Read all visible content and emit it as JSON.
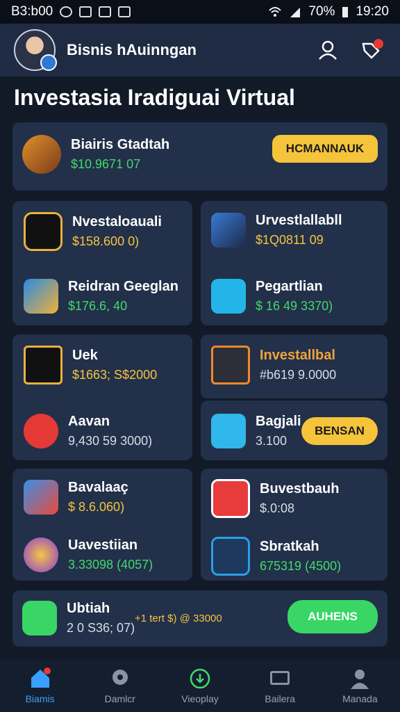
{
  "status_bar": {
    "left_time": "B3:b00",
    "battery": "70%",
    "time": "19:20"
  },
  "header": {
    "name": "Bisnis hAuinngan"
  },
  "page_title": "Investasia Iradiguai Virtual",
  "featured": {
    "name": "Biairis Gtadtah",
    "value": "$10.9671 07",
    "button": "HCMANNAUK"
  },
  "grid": [
    {
      "name": "Nvestaloauali",
      "value": "$158.600 0)",
      "color": "gold"
    },
    {
      "name": "Urvestlallabll",
      "value": "$1Q0811 09",
      "color": "gold"
    },
    {
      "name": "Reidran Geeglan",
      "value": "$176.6, 40",
      "color": "green"
    },
    {
      "name": "Pegartlian",
      "value": "$ 16 49 3370)",
      "color": "green"
    },
    {
      "name": "Uek",
      "value": "$1663; S$2000",
      "color": "gold"
    },
    {
      "name": "Investallbal",
      "value": "#b619 9.0000",
      "color": "grey"
    },
    {
      "name": "Aavan",
      "value": "9,430 59 3000)",
      "color": "grey"
    },
    {
      "name": "Bagjali",
      "value": "3.100",
      "color": "grey"
    },
    {
      "name": "Bavalaaç",
      "value": "$ 8.6.060)",
      "color": "gold"
    },
    {
      "name": "Buvestbauh",
      "value": "$.0:08",
      "color": "grey"
    },
    {
      "name": "Uavestiian",
      "value": "3.33098 (4057)",
      "color": "green"
    },
    {
      "name": "Sbratkah",
      "value": "675319 (4500)",
      "color": "green"
    }
  ],
  "bagjali_button": "BENSAN",
  "bottom_card": {
    "name": "Ubtiah",
    "value": "2 0 S36; 07)",
    "extra": "+1 tert $) @ 33000",
    "button": "AUHENS"
  },
  "nav": [
    {
      "label": "Biamis"
    },
    {
      "label": "Damlcr"
    },
    {
      "label": "Vieoplay"
    },
    {
      "label": "Bailera"
    },
    {
      "label": "Manada"
    }
  ]
}
